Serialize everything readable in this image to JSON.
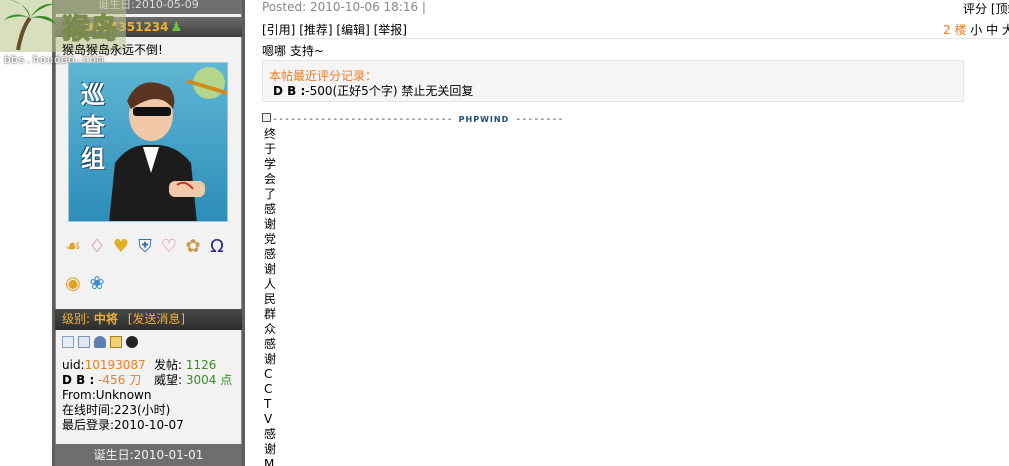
{
  "logo": {
    "url_text": "bbs.houdao.com"
  },
  "sidebar": {
    "top_date": "诞生日:2010-05-09",
    "username": "9974351234",
    "signature": "猴岛猴岛永远不倒!",
    "avatar_text": "巡查组",
    "medals": [
      "medal-bow-icon",
      "medal-ribbon-icon",
      "medal-heart-icon",
      "medal-shield-icon",
      "medal-pendant-icon",
      "medal-bunny-icon",
      "medal-omega-icon",
      "medal-coins-icon",
      "medal-flower-icon"
    ],
    "level_label": "级别:",
    "level_value": "中将",
    "send_msg": "[发送消息]",
    "tool_icons": [
      "profile-icon",
      "document-icon",
      "add-friend-icon",
      "message-icon",
      "qq-icon"
    ],
    "uid_label": "uid:",
    "uid_value": "10193087",
    "posts_label": "发帖:",
    "posts_value": "1126",
    "db_label": "D B :",
    "db_value": "-456 刀",
    "prestige_label": "威望:",
    "prestige_value": "3004 点",
    "from": "From:Unknown",
    "online": "在线时间:223(小时)",
    "last_login": "最后登录:2010-10-07",
    "bottom_date": "诞生日:2010-01-01"
  },
  "post": {
    "posted": "Posted: 2010-10-06 18:16 |",
    "rate": "评分 [顶端]",
    "menu": [
      "[引用]",
      "[推荐]",
      "[编辑]",
      "[举报]"
    ],
    "floor_num": "2 楼",
    "font_size_options": "小 中 大",
    "content": "嗯哪  支持~",
    "rating_title": "本帖最近评分记录：",
    "rating_entry_label": "D B :",
    "rating_entry_text": "-500(正好5个字) 禁止无关回复",
    "sig_left": "------------------------------",
    "sig_brand": "PHPWIND",
    "sig_right": "--------",
    "vertical_text": [
      "终",
      "于",
      "学",
      "会",
      "了",
      "感",
      "谢",
      "党",
      "感",
      "谢",
      "人",
      "民",
      "群",
      "众",
      "感",
      "谢",
      "C",
      "C",
      "T",
      "V",
      "感",
      "谢",
      "M"
    ]
  }
}
